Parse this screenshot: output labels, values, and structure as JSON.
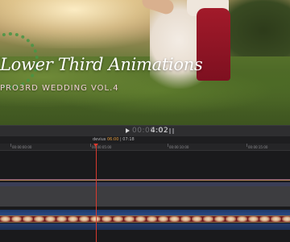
{
  "viewer": {
    "title": "Lower Third Animations",
    "subtitle": "PRO3RD WEDDING VOL.4"
  },
  "transport": {
    "timecode_dim": "00:00:0",
    "timecode": "4:02"
  },
  "timeline": {
    "clip_name": "devius",
    "clip_time_current": "06:00",
    "clip_time_total": "07:18",
    "ruler_labels": [
      "00:00:00:00",
      "00:00:05:00",
      "00:00:10:00",
      "00:00:15:00"
    ],
    "colors": {
      "playhead": "#d83a2e",
      "video_track": "#3a3e57",
      "audio_track": "#2a4a84",
      "filmstrip": "#6b1d1d"
    }
  }
}
